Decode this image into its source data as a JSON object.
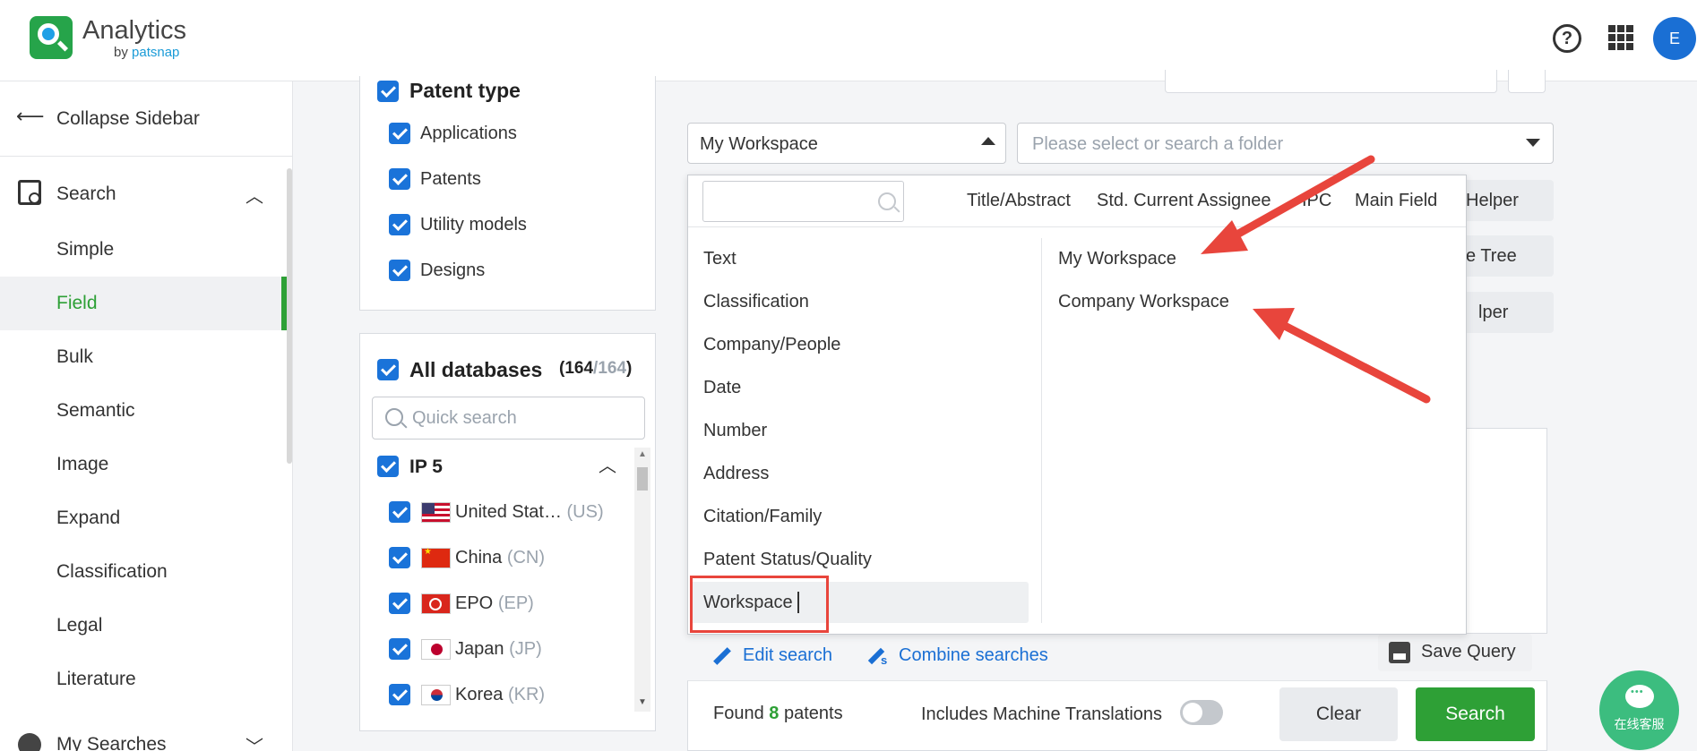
{
  "header": {
    "app_name": "Analytics",
    "by_prefix": "by",
    "by_brand": "patsnap",
    "avatar_initial": "E"
  },
  "sidebar": {
    "collapse_label": "Collapse Sidebar",
    "search_label": "Search",
    "items": [
      {
        "label": "Simple"
      },
      {
        "label": "Field"
      },
      {
        "label": "Bulk"
      },
      {
        "label": "Semantic"
      },
      {
        "label": "Image"
      },
      {
        "label": "Expand"
      },
      {
        "label": "Classification"
      },
      {
        "label": "Legal"
      },
      {
        "label": "Literature"
      }
    ],
    "active_item": "Field",
    "my_searches_label": "My Searches"
  },
  "patent_type": {
    "title": "Patent type",
    "items": [
      "Applications",
      "Patents",
      "Utility models",
      "Designs"
    ]
  },
  "databases": {
    "title": "All databases",
    "count_selected": "164",
    "count_total": "164",
    "search_placeholder": "Quick search",
    "group_label": "IP 5",
    "countries": [
      {
        "name": "United Stat…",
        "code": "(US)"
      },
      {
        "name": "China",
        "code": "(CN)"
      },
      {
        "name": "EPO",
        "code": "(EP)"
      },
      {
        "name": "Japan",
        "code": "(JP)"
      },
      {
        "name": "Korea",
        "code": "(KR)"
      }
    ]
  },
  "workspace_select": {
    "value": "My Workspace"
  },
  "folder_select": {
    "placeholder": "Please select or search a folder"
  },
  "dropdown": {
    "search_value": "",
    "tabs": [
      "Title/Abstract",
      "Std. Current Assignee",
      "IPC",
      "Main Field"
    ],
    "categories": [
      "Text",
      "Classification",
      "Company/People",
      "Date",
      "Number",
      "Address",
      "Citation/Family",
      "Patent Status/Quality",
      "Workspace"
    ],
    "active_category": "Workspace",
    "sub_options": [
      "My Workspace",
      "Company Workspace"
    ]
  },
  "helpers": {
    "btn1_partial": "Helper",
    "btn2_partial": "e Tree",
    "btn3_partial": "lper"
  },
  "editor": {
    "edit_search": "Edit search",
    "combine_searches": "Combine searches",
    "save_query": "Save Query"
  },
  "footer": {
    "found_prefix": "Found",
    "found_count": "8",
    "found_suffix": "patents",
    "machine_translations": "Includes Machine Translations",
    "machine_translations_on": false,
    "clear": "Clear",
    "search": "Search"
  },
  "chat": {
    "label": "在线客服"
  },
  "annotation": {
    "arrow_color": "#e8453c",
    "highlight_color": "#e8453c"
  }
}
